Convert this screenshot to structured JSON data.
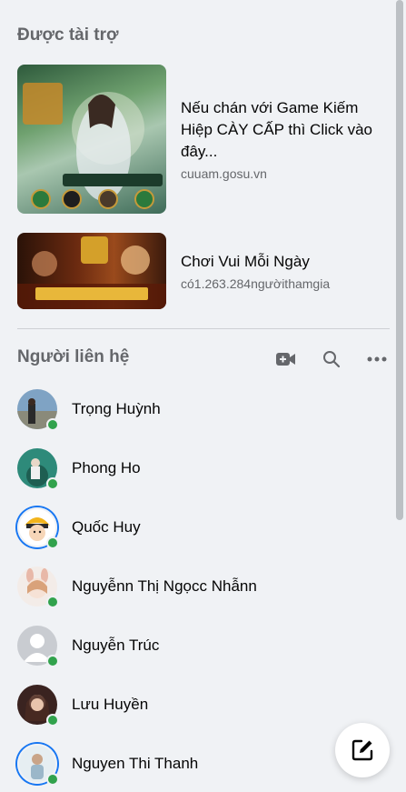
{
  "sponsored": {
    "title": "Được tài trợ",
    "ads": [
      {
        "headline": "Nếu chán với Game Kiếm Hiệp CÀY CẤP thì Click vào đây...",
        "domain": "cuuam.gosu.vn"
      },
      {
        "headline": "Chơi Vui Mỗi Ngày",
        "domain": "có1.263.284ngườithamgia"
      }
    ]
  },
  "contacts": {
    "title": "Người liên hệ",
    "tools": {
      "video": "video-call-icon",
      "search": "search-icon",
      "more": "more-icon"
    },
    "items": [
      {
        "name": "Trọng Huỳnh",
        "online": true
      },
      {
        "name": "Phong Ho",
        "online": true
      },
      {
        "name": "Quốc Huy",
        "online": true
      },
      {
        "name": "Nguyễnn Thị Ngọcc Nhẫnn",
        "online": true
      },
      {
        "name": "Nguyễn Trúc",
        "online": true
      },
      {
        "name": "Lưu Huyền",
        "online": true
      },
      {
        "name": "Nguyen Thi Thanh",
        "online": true
      }
    ]
  },
  "compose": {
    "icon": "compose-icon"
  },
  "colors": {
    "online": "#31a24c",
    "accent": "#1877f2",
    "background": "#f0f2f5",
    "secondary_text": "#65676b"
  }
}
